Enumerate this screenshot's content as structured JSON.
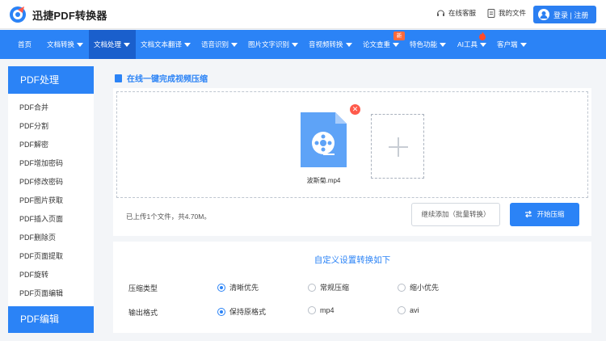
{
  "header": {
    "brand": "迅捷PDF转换器",
    "service_label": "在线客服",
    "files_label": "我的文件",
    "login_label": "登录 | 注册"
  },
  "nav": {
    "items": [
      {
        "label": "首页",
        "caret": false
      },
      {
        "label": "文档转换",
        "caret": true
      },
      {
        "label": "文档处理",
        "caret": true,
        "active": true
      },
      {
        "label": "文档文本翻译",
        "caret": true
      },
      {
        "label": "语音识别",
        "caret": true
      },
      {
        "label": "图片文字识别",
        "caret": true
      },
      {
        "label": "音视频转换",
        "caret": true
      },
      {
        "label": "论文查重",
        "caret": true
      },
      {
        "label": "特色功能",
        "caret": true
      },
      {
        "label": "AI工具",
        "caret": true
      },
      {
        "label": "客户端",
        "caret": true
      }
    ],
    "new_badge": "新"
  },
  "sidebar": {
    "heading": "PDF处理",
    "items": [
      "PDF合并",
      "PDF分割",
      "PDF解密",
      "PDF增加密码",
      "PDF修改密码",
      "PDF图片获取",
      "PDF插入页面",
      "PDF删除页",
      "PDF页面提取",
      "PDF旋转",
      "PDF页面编辑"
    ],
    "heading2": "PDF编辑"
  },
  "main": {
    "title": "在线一键完成视频压缩",
    "file_name": "波斯菊.mp4",
    "status": "已上传1个文件，共4.70M。",
    "continue_label": "继续添加（批量转换）",
    "start_label": "开始压缩"
  },
  "settings": {
    "title": "自定义设置转换如下",
    "compress_label": "压缩类型",
    "compress_options": [
      "清晰优先",
      "常规压缩",
      "缩小优先"
    ],
    "compress_selected": "清晰优先",
    "format_label": "输出格式",
    "format_options": [
      "保持原格式",
      "mp4",
      "avi"
    ],
    "format_selected": "保持原格式"
  },
  "colors": {
    "primary": "#2b83f6",
    "active_nav": "#1a5fcc",
    "danger": "#ff5a4b"
  }
}
